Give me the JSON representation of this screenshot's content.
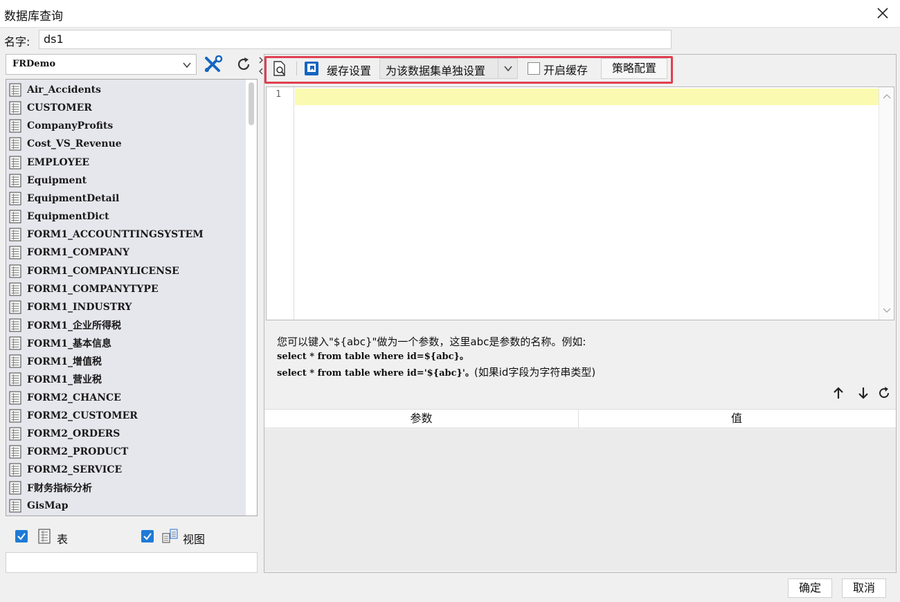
{
  "window": {
    "title": "数据库查询"
  },
  "name_row": {
    "label": "名字:",
    "value": "ds1"
  },
  "connection": {
    "selected": "FRDemo"
  },
  "tables": [
    "Air_Accidents",
    "CUSTOMER",
    "CompanyProfits",
    "Cost_VS_Revenue",
    "EMPLOYEE",
    "Equipment",
    "EquipmentDetail",
    "EquipmentDict",
    "FORM1_ACCOUNTTINGSYSTEM",
    "FORM1_COMPANY",
    "FORM1_COMPANYLICENSE",
    "FORM1_COMPANYTYPE",
    "FORM1_INDUSTRY",
    "FORM1_企业所得税",
    "FORM1_基本信息",
    "FORM1_增值税",
    "FORM1_营业税",
    "FORM2_CHANCE",
    "FORM2_CUSTOMER",
    "FORM2_ORDERS",
    "FORM2_PRODUCT",
    "FORM2_SERVICE",
    "F财务指标分析",
    "GisMap"
  ],
  "filters": {
    "tables_label": "表",
    "views_label": "视图",
    "tables_checked": true,
    "views_checked": true
  },
  "toolbar": {
    "cache_label": "缓存设置",
    "cache_mode": "为该数据集单独设置",
    "enable_cache_label": "开启缓存",
    "enable_cache_checked": false,
    "policy_button": "策略配置"
  },
  "editor": {
    "line_numbers": [
      "1"
    ],
    "content": ""
  },
  "hint": {
    "line1": "您可以键入\"${abc}\"做为一个参数，这里abc是参数的名称。例如:",
    "line2": "select * from table where id=${abc}。",
    "line3_code": "select * from table where id='${abc}'。",
    "line3_note": "(如果id字段为字符串类型)"
  },
  "params_table": {
    "col_param": "参数",
    "col_value": "值",
    "rows": []
  },
  "footer": {
    "ok": "确定",
    "cancel": "取消"
  },
  "colors": {
    "highlight_border": "#e04050",
    "active_line": "#fafab0",
    "checkbox": "#1e7ad6"
  }
}
